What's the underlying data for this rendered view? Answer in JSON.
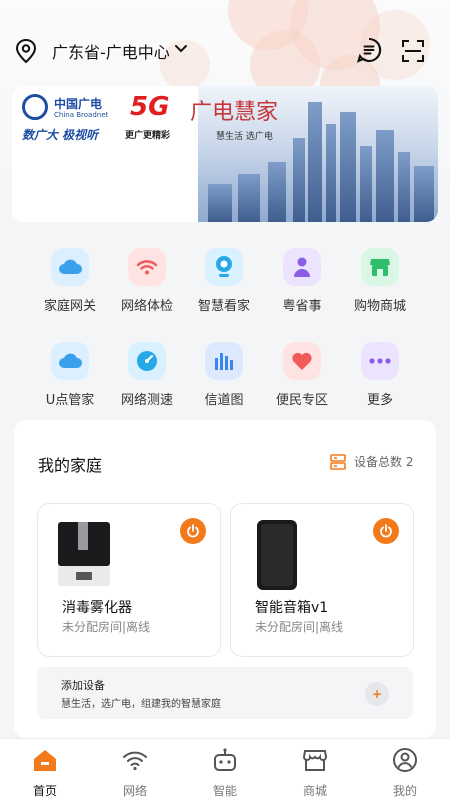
{
  "header": {
    "location": "广东省-广电中心"
  },
  "banner": {
    "brand_cn": "中国广电",
    "brand_en": "China Broadnet",
    "slogan": "数广大 极视听",
    "g5": "5G",
    "g5_sub": "更广更精彩",
    "huijia": "广电慧家",
    "huijia_sub": "慧生活 选广电"
  },
  "quick": [
    {
      "label": "家庭网关",
      "icon": "cloud-gateway-icon",
      "color": "#3aa0ec"
    },
    {
      "label": "网络体检",
      "icon": "wifi-check-icon",
      "color": "#f05a5a"
    },
    {
      "label": "智慧看家",
      "icon": "camera-icon",
      "color": "#25a8e8"
    },
    {
      "label": "粤省事",
      "icon": "person-icon",
      "color": "#8a5ce8"
    },
    {
      "label": "购物商城",
      "icon": "shop-icon",
      "color": "#2fbf6a"
    },
    {
      "label": "U点管家",
      "icon": "cloud-icon",
      "color": "#3aa0ec"
    },
    {
      "label": "网络测速",
      "icon": "speedometer-icon",
      "color": "#25a8e8"
    },
    {
      "label": "信道图",
      "icon": "bar-chart-icon",
      "color": "#3a86e8"
    },
    {
      "label": "便民专区",
      "icon": "heart-hand-icon",
      "color": "#f05a5a"
    },
    {
      "label": "更多",
      "icon": "more-icon",
      "color": "#8a5ce8"
    }
  ],
  "home": {
    "title": "我的家庭",
    "device_count": "设备总数 2",
    "devices": [
      {
        "name": "消毒雾化器",
        "status": "未分配房间|离线"
      },
      {
        "name": "智能音箱v1",
        "status": "未分配房间|离线"
      }
    ],
    "add": {
      "title": "添加设备",
      "subtitle": "慧生活，选广电，组建我的智慧家庭",
      "button": "+"
    }
  },
  "tabs": [
    {
      "label": "首页",
      "icon": "home-icon"
    },
    {
      "label": "网络",
      "icon": "wifi-icon"
    },
    {
      "label": "智能",
      "icon": "robot-icon"
    },
    {
      "label": "商城",
      "icon": "store-icon"
    },
    {
      "label": "我的",
      "icon": "user-icon"
    }
  ],
  "colors": {
    "accent": "#f27a1a",
    "background": "#f4f5f7"
  }
}
